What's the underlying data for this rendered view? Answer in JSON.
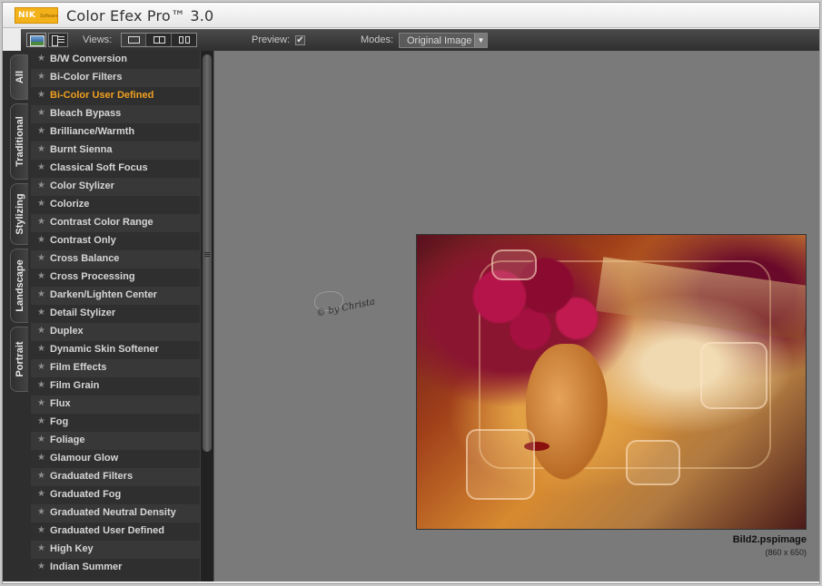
{
  "app": {
    "logo_text": "NIK",
    "logo_subtext": "Software",
    "title": "Color Efex Pro™ 3.0"
  },
  "toolbar": {
    "views_label": "Views:",
    "preview_label": "Preview:",
    "preview_checked": true,
    "preview_check_glyph": "✔",
    "modes_label": "Modes:",
    "mode_value": "Original Image",
    "mode_arrow": "▼"
  },
  "side_tabs": [
    "All",
    "Traditional",
    "Stylizing",
    "Landscape",
    "Portrait"
  ],
  "active_tab": "All",
  "filters": [
    "B/W Conversion",
    "Bi-Color Filters",
    "Bi-Color User Defined",
    "Bleach Bypass",
    "Brilliance/Warmth",
    "Burnt Sienna",
    "Classical Soft Focus",
    "Color Stylizer",
    "Colorize",
    "Contrast Color Range",
    "Contrast Only",
    "Cross Balance",
    "Cross Processing",
    "Darken/Lighten Center",
    "Detail Stylizer",
    "Duplex",
    "Dynamic Skin Softener",
    "Film Effects",
    "Film Grain",
    "Flux",
    "Fog",
    "Foliage",
    "Glamour Glow",
    "Graduated Filters",
    "Graduated Fog",
    "Graduated Neutral Density",
    "Graduated User Defined",
    "High Key",
    "Indian Summer"
  ],
  "selected_filter": "Bi-Color User Defined",
  "star_glyph": "★",
  "preview": {
    "watermark_text": "© by Christa",
    "image_name": "Bild2.pspimage",
    "image_dims": "(860 x 650)"
  },
  "colors": {
    "selected_filter_text": "#f0a020",
    "logo_bg": "#f3b21a"
  }
}
